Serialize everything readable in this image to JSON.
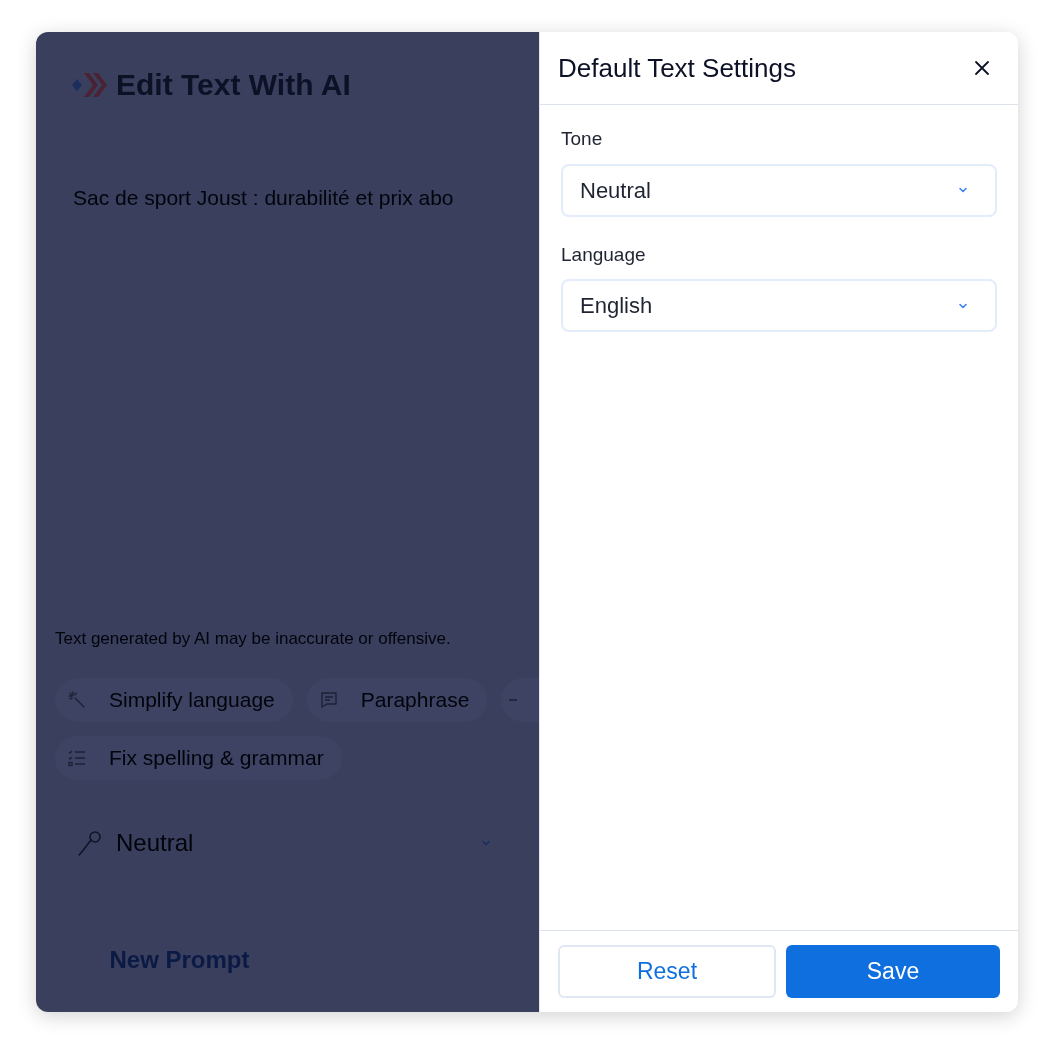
{
  "editor": {
    "title": "Edit Text With AI",
    "text": "Sac de sport Joust : durabilité et prix abo",
    "disclaimer": "Text generated by AI may be inaccurate or offensive.",
    "actions": [
      {
        "kind": "wand",
        "label": "Simplify language"
      },
      {
        "kind": "message",
        "label": "Paraphrase"
      },
      {
        "kind": "cut"
      },
      {
        "kind": "list",
        "label": "Fix spelling & grammar"
      }
    ],
    "tone": {
      "value": "Neutral"
    },
    "footer_button": "New Prompt"
  },
  "settings": {
    "title": "Default Text Settings",
    "fields": [
      {
        "label": "Tone",
        "value": "Neutral"
      },
      {
        "label": "Language",
        "value": "English"
      }
    ],
    "buttons": [
      {
        "kind": "secondary",
        "label": "Reset"
      },
      {
        "kind": "primary",
        "label": "Save"
      }
    ]
  }
}
